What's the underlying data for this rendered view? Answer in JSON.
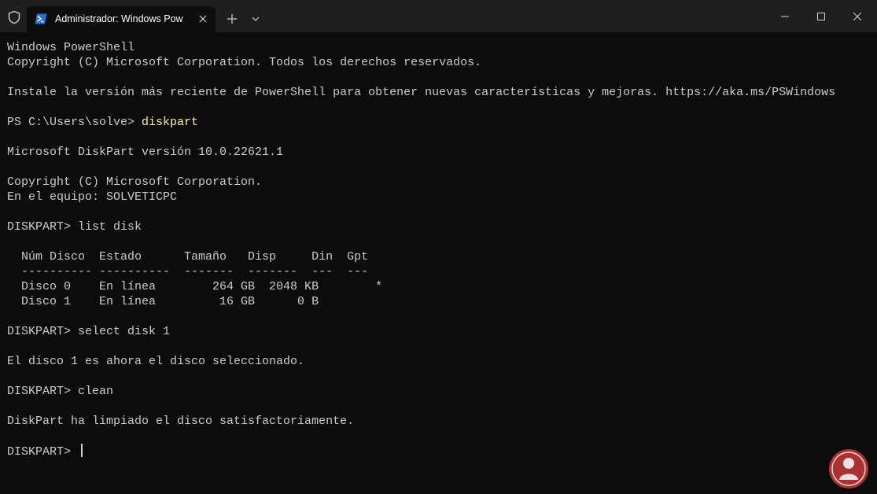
{
  "tab": {
    "title": "Administrador: Windows Pow",
    "icon": "powershell-icon"
  },
  "window_controls": [
    "minimize-icon",
    "maximize-icon",
    "close-icon"
  ],
  "terminal": {
    "lines": [
      "Windows PowerShell",
      "Copyright (C) Microsoft Corporation. Todos los derechos reservados.",
      "",
      "Instale la versión más reciente de PowerShell para obtener nuevas características y mejoras. https://aka.ms/PSWindows",
      "",
      "",
      "",
      "Microsoft DiskPart versión 10.0.22621.1",
      "",
      "Copyright (C) Microsoft Corporation.",
      "En el equipo: SOLVETICPC",
      "",
      "DISKPART> list disk",
      "",
      "  Núm Disco  Estado      Tamaño   Disp     Din  Gpt",
      "  ---------- ----------  -------  -------  ---  ---",
      "  Disco 0    En línea        264 GB  2048 KB        *",
      "  Disco 1    En línea         16 GB      0 B",
      "",
      "DISKPART> select disk 1",
      "",
      "El disco 1 es ahora el disco seleccionado.",
      "",
      "DISKPART> clean",
      "",
      "DiskPart ha limpiado el disco satisfactoriamente.",
      "",
      ""
    ],
    "prompt_ps": "PS C:\\Users\\solve> ",
    "prompt_ps_cmd": "diskpart",
    "final_prompt": "DISKPART> "
  },
  "colors": {
    "background": "#0c0c0c",
    "text": "#cccccc",
    "command": "#f9f1a5",
    "titlebar": "#1f1f1f"
  }
}
